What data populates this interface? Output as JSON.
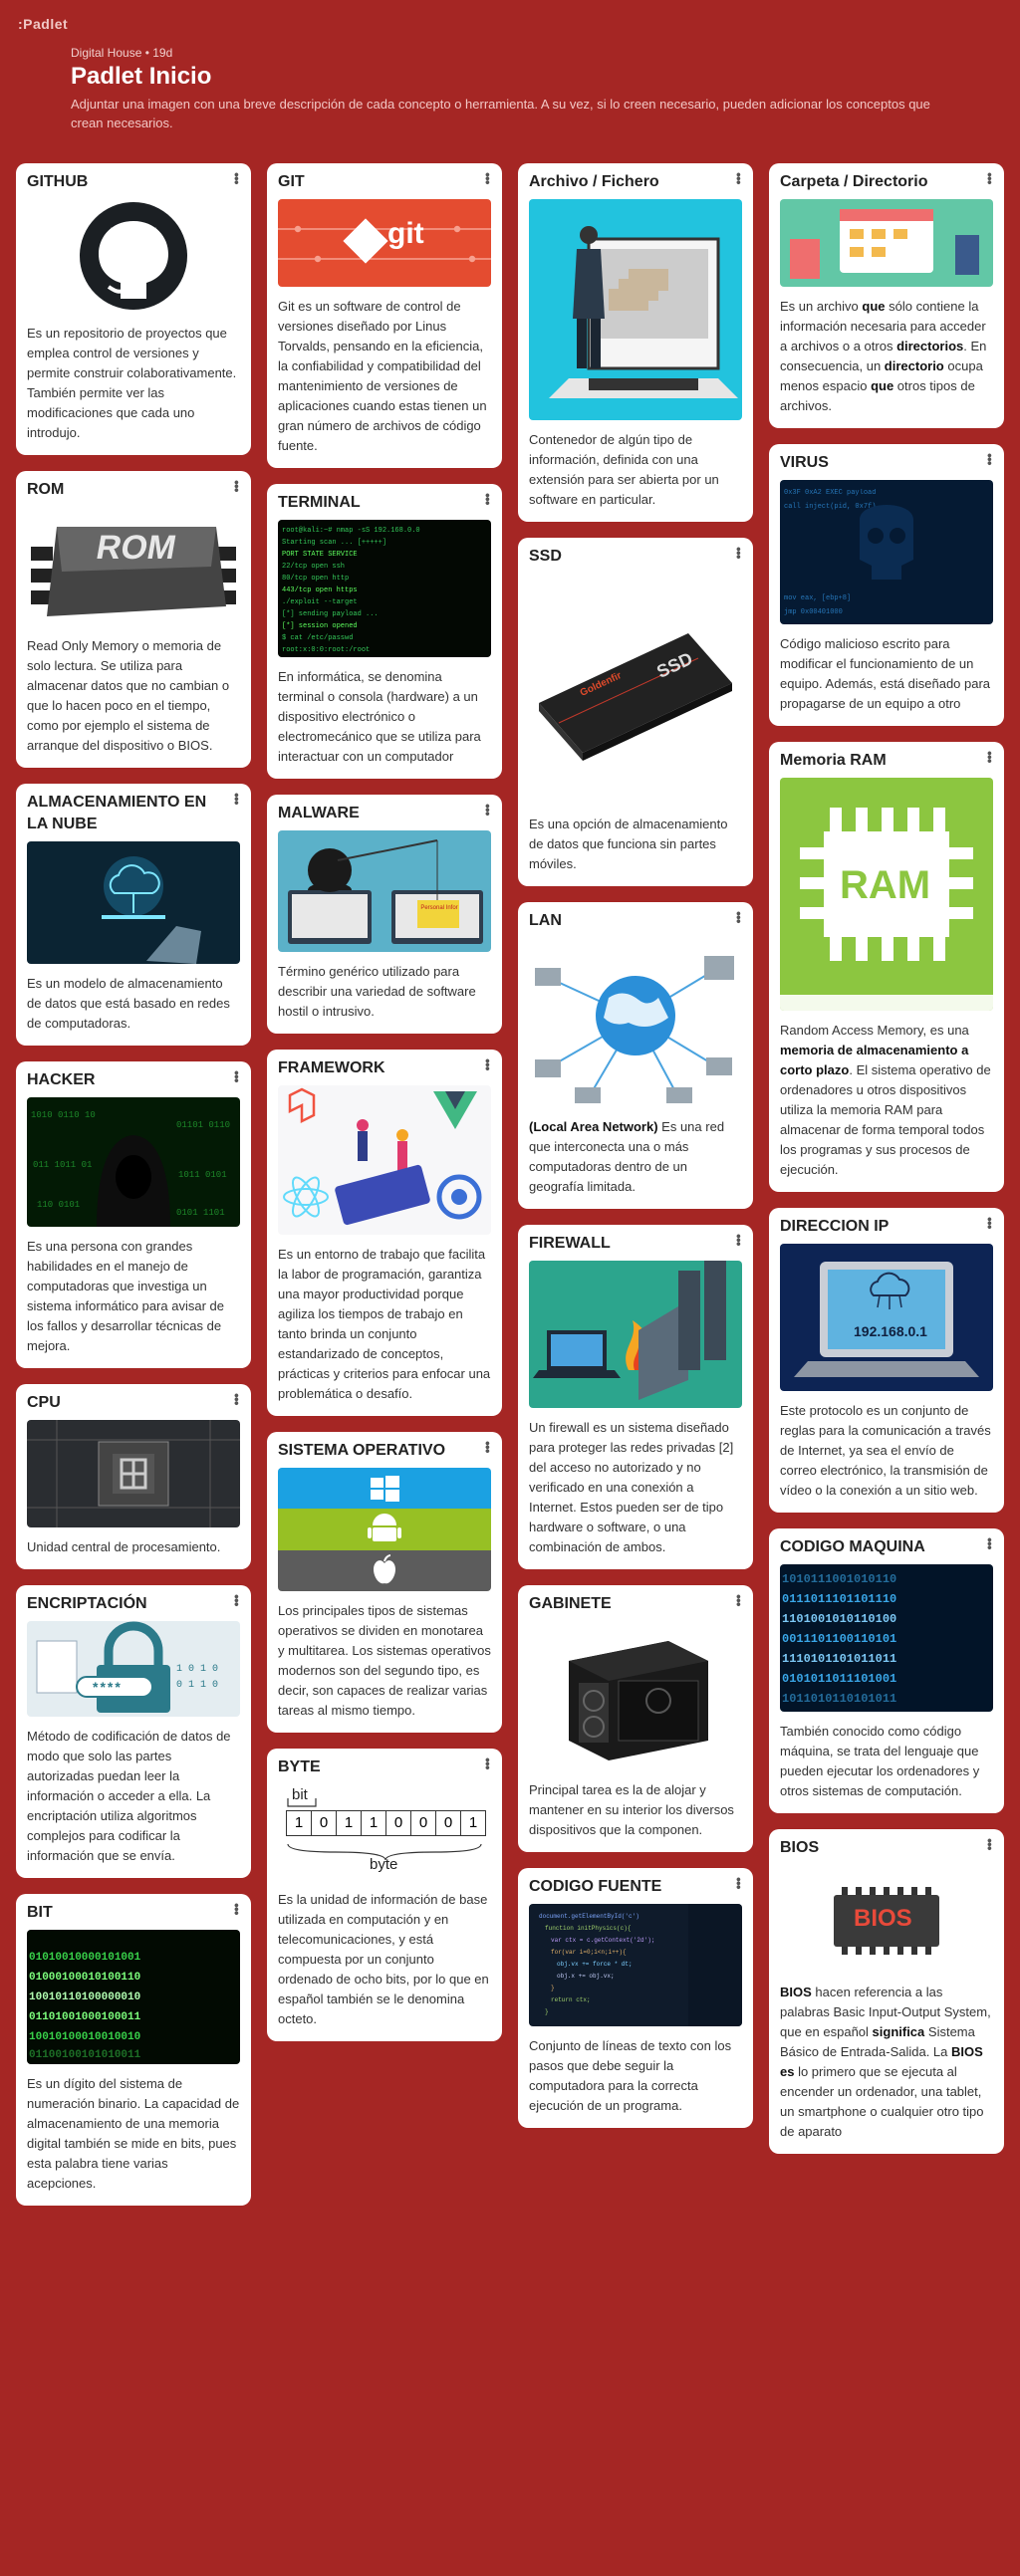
{
  "app": {
    "logo": ":Padlet"
  },
  "header": {
    "author": "Digital House",
    "age": "19d",
    "title": "Padlet Inicio",
    "description": "Adjuntar una imagen con una breve descripción de cada concepto o herramienta. A su vez, si lo creen necesario, pueden adicionar los conceptos que crean necesarios."
  },
  "cards": {
    "github": {
      "title": "GITHUB",
      "text": "Es un repositorio de proyectos que emplea control de versiones y permite construir colaborativamente. También permite ver las modificaciones que cada uno introdujo."
    },
    "rom": {
      "title": "ROM",
      "img_label": "ROM",
      "text": "Read Only Memory o memoria de solo lectura.  Se utiliza para almacenar datos que no cambian o que lo hacen poco en el tiempo, como por ejemplo el sistema de arranque del dispositivo o BIOS."
    },
    "nube": {
      "title": "ALMACENAMIENTO EN LA NUBE",
      "text": "Es un modelo de almacenamiento de datos que está basado en redes de computadoras."
    },
    "hacker": {
      "title": "HACKER",
      "text": "Es una persona con grandes habilidades en el manejo de computadoras que investiga un sistema informático para avisar de los fallos y desarrollar técnicas de mejora."
    },
    "cpu": {
      "title": "CPU",
      "text": "Unidad central de procesamiento."
    },
    "encriptacion": {
      "title": "ENCRIPTACIÓN",
      "img_label": "****",
      "text": "Método de codificación de datos de modo que solo las partes autorizadas puedan leer la información o acceder a ella. La encriptación utiliza algoritmos complejos para codificar la información que se envía."
    },
    "bit": {
      "title": "BIT",
      "text": "Es un dígito del sistema de numeración binario. La capacidad de almacenamiento de una memoria digital también se mide en bits, pues esta palabra tiene varias acepciones."
    },
    "git": {
      "title": "GIT",
      "img_label": "git",
      "text": "Git es un software de control de versiones diseñado por Linus Torvalds, pensando en la eficiencia, la confiabilidad y compatibilidad del mantenimiento de versiones de aplicaciones cuando estas tienen un gran número de archivos de código fuente."
    },
    "terminal": {
      "title": "TERMINAL",
      "text": "En informática, se denomina terminal o consola (hardware) a un dispositivo electrónico o electromecánico que se utiliza para interactuar con un computador"
    },
    "malware": {
      "title": "MALWARE",
      "img_label": "Personal Infor",
      "text": "Término genérico utilizado para describir una variedad de software hostil o intrusivo."
    },
    "framework": {
      "title": "FRAMEWORK",
      "text": "Es un entorno de trabajo que facilita la labor de programación, garantiza una mayor productividad porque agiliza los tiempos de trabajo en tanto brinda un conjunto estandarizado de conceptos, prácticas y criterios para enfocar una problemática o desafío."
    },
    "so": {
      "title": "SISTEMA OPERATIVO",
      "text": "Los principales tipos de sistemas operativos se dividen en monotarea y multitarea. Los sistemas operativos modernos son del segundo tipo, es decir, son capaces de realizar varias tareas al mismo tiempo."
    },
    "byte": {
      "title": "BYTE",
      "bit_label": "bit",
      "byte_label": "byte",
      "bits": [
        "1",
        "0",
        "1",
        "1",
        "0",
        "0",
        "0",
        "1"
      ],
      "text": "Es la unidad de información de base utilizada en computación y en telecomunicaciones, y está compuesta por un conjunto ordenado de ocho bits,  por lo que en español también se le denomina octeto."
    },
    "archivo": {
      "title": "Archivo / Fichero",
      "text": "Contenedor de algún tipo de información, definida con una extensión para ser abierta por un software en particular."
    },
    "ssd": {
      "title": "SSD",
      "img_label": "SSD",
      "img_brand": "Goldenfir",
      "text": "Es una opción de almacenamiento de datos que funciona sin partes móviles."
    },
    "lan": {
      "title": "LAN",
      "text_bold": "(Local Area Network)",
      "text": " Es una red que interconecta una o más computadoras dentro de un geografía limitada."
    },
    "firewall": {
      "title": "FIREWALL",
      "text": "Un firewall es un sistema diseñado para proteger las redes privadas [2] del acceso no autorizado y no verificado en una conexión a Internet. Estos pueden ser de tipo hardware o software, o una combinación de ambos."
    },
    "gabinete": {
      "title": "GABINETE",
      "text": "Principal tarea es la de alojar y mantener en su interior los diversos dispositivos que la componen."
    },
    "codigofuente": {
      "title": "CODIGO FUENTE",
      "text": "Conjunto de líneas de texto con los pasos que debe seguir la computadora para la correcta ejecución de un programa."
    },
    "carpeta": {
      "title": "Carpeta / Directorio",
      "t1": "Es un archivo ",
      "b1": "que",
      "t2": " sólo contiene la información necesaria para acceder a archivos o a otros ",
      "b2": "directorios",
      "t3": ". En consecuencia, un ",
      "b3": "directorio",
      "t4": " ocupa menos espacio ",
      "b4": "que",
      "t5": " otros tipos de archivos."
    },
    "virus": {
      "title": "VIRUS",
      "text": "Código malicioso escrito para modificar el funcionamiento de un equipo. Además, está diseñado para propagarse de un equipo a otro"
    },
    "ram": {
      "title": "Memoria RAM",
      "img_label": "RAM",
      "t1": "Random Access Memory, es una ",
      "b1": "memoria de almacenamiento a corto plazo",
      "t2": ". El sistema operativo de ordenadores u otros dispositivos utiliza la memoria RAM para almacenar de forma temporal todos los programas y sus procesos de ejecución."
    },
    "ip": {
      "title": "DIRECCION IP",
      "img_label": "192.168.0.1",
      "text": "Este protocolo es un conjunto de reglas para la comunicación a través de Internet, ya sea el envío de correo electrónico, la transmisión de vídeo o la conexión a un sitio web."
    },
    "codigomaquina": {
      "title": "CODIGO MAQUINA",
      "text": "También conocido como código máquina, se trata del lenguaje que pueden ejecutar los ordenadores y otros sistemas de computación."
    },
    "bios": {
      "title": "BIOS",
      "img_label": "BIOS",
      "b1": "BIOS",
      "t1": " hacen referencia a las palabras Basic Input-Output System, que en español ",
      "b2": "significa",
      "t2": " Sistema Básico de Entrada-Salida. La ",
      "b3": "BIOS es",
      "t3": " lo primero que se ejecuta al encender un ordenador, una tablet, un smartphone o cualquier otro tipo de aparato"
    }
  },
  "colors": {
    "background": "#a52624",
    "card": "#ffffff"
  }
}
